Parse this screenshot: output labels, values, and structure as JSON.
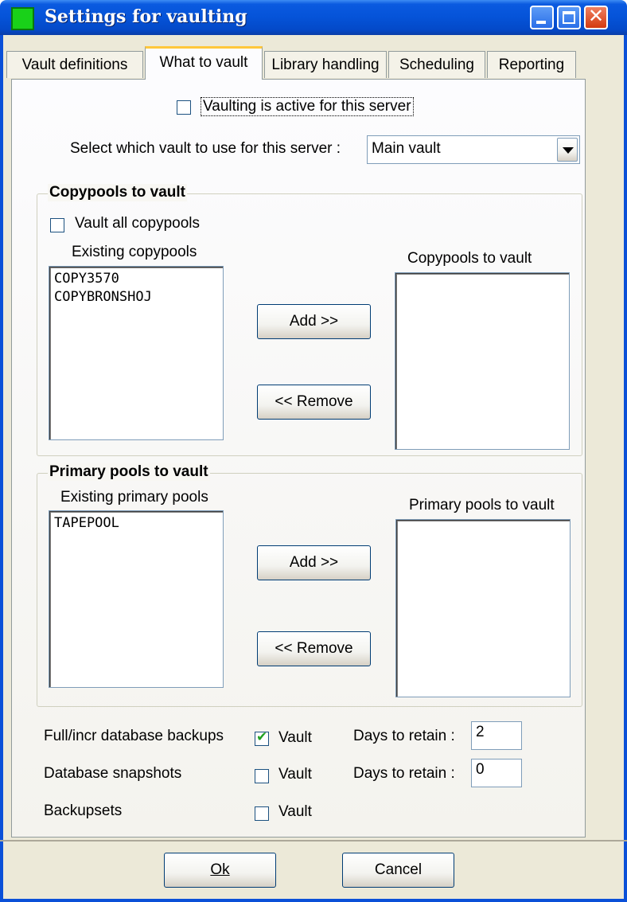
{
  "window": {
    "title": "Settings for vaulting"
  },
  "tabs": [
    {
      "label": "Vault definitions"
    },
    {
      "label": "What to vault"
    },
    {
      "label": "Library handling"
    },
    {
      "label": "Scheduling"
    },
    {
      "label": "Reporting"
    }
  ],
  "active_tab": "What to vault",
  "vaulting_active": {
    "label": "Vaulting is active for this server",
    "checked": false
  },
  "vault_select": {
    "label": "Select which vault to use for this server :",
    "value": "Main vault"
  },
  "copypools": {
    "group_title": "Copypools to vault",
    "vault_all": {
      "label": "Vault all copypools",
      "checked": false
    },
    "existing_label": "Existing copypools",
    "existing_items": [
      "COPY3570",
      "COPYBRONSHOJ"
    ],
    "to_vault_label": "Copypools to vault",
    "to_vault_items": [],
    "add_label": "Add >>",
    "remove_label": "<< Remove"
  },
  "primary": {
    "group_title": "Primary pools to vault",
    "existing_label": "Existing primary pools",
    "existing_items": [
      "TAPEPOOL"
    ],
    "to_vault_label": "Primary pools to vault",
    "to_vault_items": [],
    "add_label": "Add >>",
    "remove_label": "<< Remove"
  },
  "backups": [
    {
      "label": "Full/incr database backups",
      "vault_label": "Vault",
      "checked": true,
      "days_label": "Days to retain :",
      "days": "2"
    },
    {
      "label": "Database snapshots",
      "vault_label": "Vault",
      "checked": false,
      "days_label": "Days to retain :",
      "days": "0"
    },
    {
      "label": "Backupsets",
      "vault_label": "Vault",
      "checked": false
    }
  ],
  "footer": {
    "ok_label": "Ok",
    "cancel_label": "Cancel"
  }
}
